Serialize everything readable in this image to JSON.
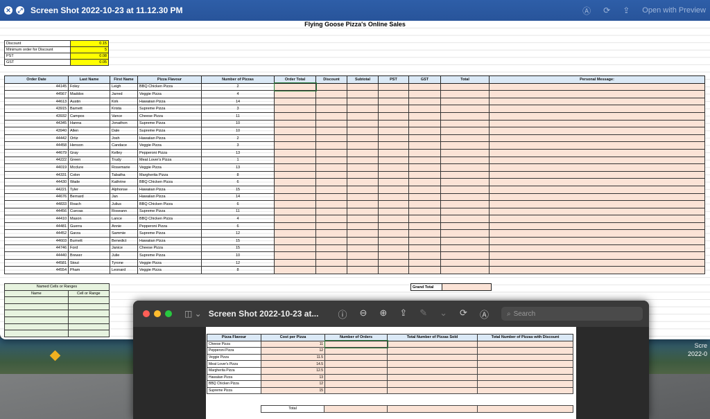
{
  "window": {
    "title": "Screen Shot 2022-10-23 at 11.12.30 PM",
    "open_with": "Open with Preview"
  },
  "sheet": {
    "title": "Flying Goose Pizza's Online Sales",
    "params": [
      {
        "label": "Discount",
        "value": "0.15"
      },
      {
        "label": "Minimum order for Discount",
        "value": "5"
      },
      {
        "label": "PST",
        "value": "0.08"
      },
      {
        "label": "GST",
        "value": "0.05"
      }
    ],
    "headers": [
      "Order Date",
      "Last Name",
      "First Name",
      "Pizza Flavour",
      "Number of Pizzas",
      "Order Total",
      "Discount",
      "Subtotal",
      "PST",
      "GST",
      "Total",
      "Personal Message:"
    ],
    "rows": [
      [
        "44145",
        "Foley",
        "Leigh",
        "BBQ Chicken Pizza",
        "2"
      ],
      [
        "44567",
        "Maddox",
        "Jarred",
        "Veggie Pizza",
        "4"
      ],
      [
        "44613",
        "Austin",
        "Kirk",
        "Hawaiian Pizza",
        "14"
      ],
      [
        "43915",
        "Barnett",
        "Krista",
        "Supreme Pizza",
        "3"
      ],
      [
        "43932",
        "Campos",
        "Vance",
        "Cheese Pizza",
        "11"
      ],
      [
        "44345",
        "Hanna",
        "Jonathon",
        "Supreme Pizza",
        "10"
      ],
      [
        "43940",
        "Allen",
        "Dale",
        "Supreme Pizza",
        "10"
      ],
      [
        "44442",
        "Ortiz",
        "Josh",
        "Hawaiian Pizza",
        "2"
      ],
      [
        "44458",
        "Henson",
        "Candace",
        "Veggie Pizza",
        "3"
      ],
      [
        "44679",
        "Gray",
        "Kelley",
        "Pepperoni Pizza",
        "13"
      ],
      [
        "44222",
        "Green",
        "Trudy",
        "Meat Lover's Pizza",
        "1"
      ],
      [
        "44019",
        "Mcclure",
        "Rosemarie",
        "Veggie Pizza",
        "13"
      ],
      [
        "44331",
        "Colon",
        "Tabatha",
        "Margherita Pizza",
        "8"
      ],
      [
        "44430",
        "Wade",
        "Kathrine",
        "BBQ Chicken Pizza",
        "6"
      ],
      [
        "44221",
        "Tyler",
        "Alphonse",
        "Hawaiian Pizza",
        "15"
      ],
      [
        "44676",
        "Bernard",
        "Jan",
        "Hawaiian Pizza",
        "14"
      ],
      [
        "44833",
        "Roach",
        "Julius",
        "BBQ Chicken Pizza",
        "6"
      ],
      [
        "44456",
        "Cuevas",
        "Roseann",
        "Supreme Pizza",
        "11"
      ],
      [
        "44410",
        "Mason",
        "Lance",
        "BBQ Chicken Pizza",
        "4"
      ],
      [
        "44481",
        "Guerra",
        "Annie",
        "Pepperoni Pizza",
        "6"
      ],
      [
        "44452",
        "Garza",
        "Sammie",
        "Supreme Pizza",
        "12"
      ],
      [
        "44603",
        "Burnett",
        "Benedict",
        "Hawaiian Pizza",
        "15"
      ],
      [
        "44746",
        "Ford",
        "Janice",
        "Cheese Pizza",
        "15"
      ],
      [
        "44440",
        "Brewer",
        "Julie",
        "Supreme Pizza",
        "10"
      ],
      [
        "44581",
        "Stout",
        "Tyrone",
        "Veggie Pizza",
        "12"
      ],
      [
        "44554",
        "Pham",
        "Leonard",
        "Veggie Pizza",
        "8"
      ]
    ],
    "grand_total_label": "Grand Total",
    "named_cells": {
      "title": "Named Cells or Ranges",
      "col_name": "Name",
      "col_range": "Cell or Range"
    }
  },
  "preview": {
    "title": "Screen Shot 2022-10-23 at...",
    "search_placeholder": "Search",
    "headers": [
      "Pizza Flavour",
      "Cost per Pizza",
      "Number of Orders",
      "Total Number of Pizzas Sold",
      "Total Number of Pizzas with Discount"
    ],
    "rows": [
      [
        "Cheese Pizza",
        "11"
      ],
      [
        "Pepperoni Pizza",
        "12"
      ],
      [
        "Veggie Pizza",
        "11.5"
      ],
      [
        "Meat Lover's Pizza",
        "14.5"
      ],
      [
        "Margherita Pizza",
        "12.5"
      ],
      [
        "Hawaiian Pizza",
        "13"
      ],
      [
        "BBQ Chicken Pizza",
        "12"
      ],
      [
        "Supreme Pizza",
        "15"
      ]
    ],
    "total_label": "Total"
  },
  "desktop": {
    "label_line1": "Scre",
    "label_line2": "2022-0"
  }
}
